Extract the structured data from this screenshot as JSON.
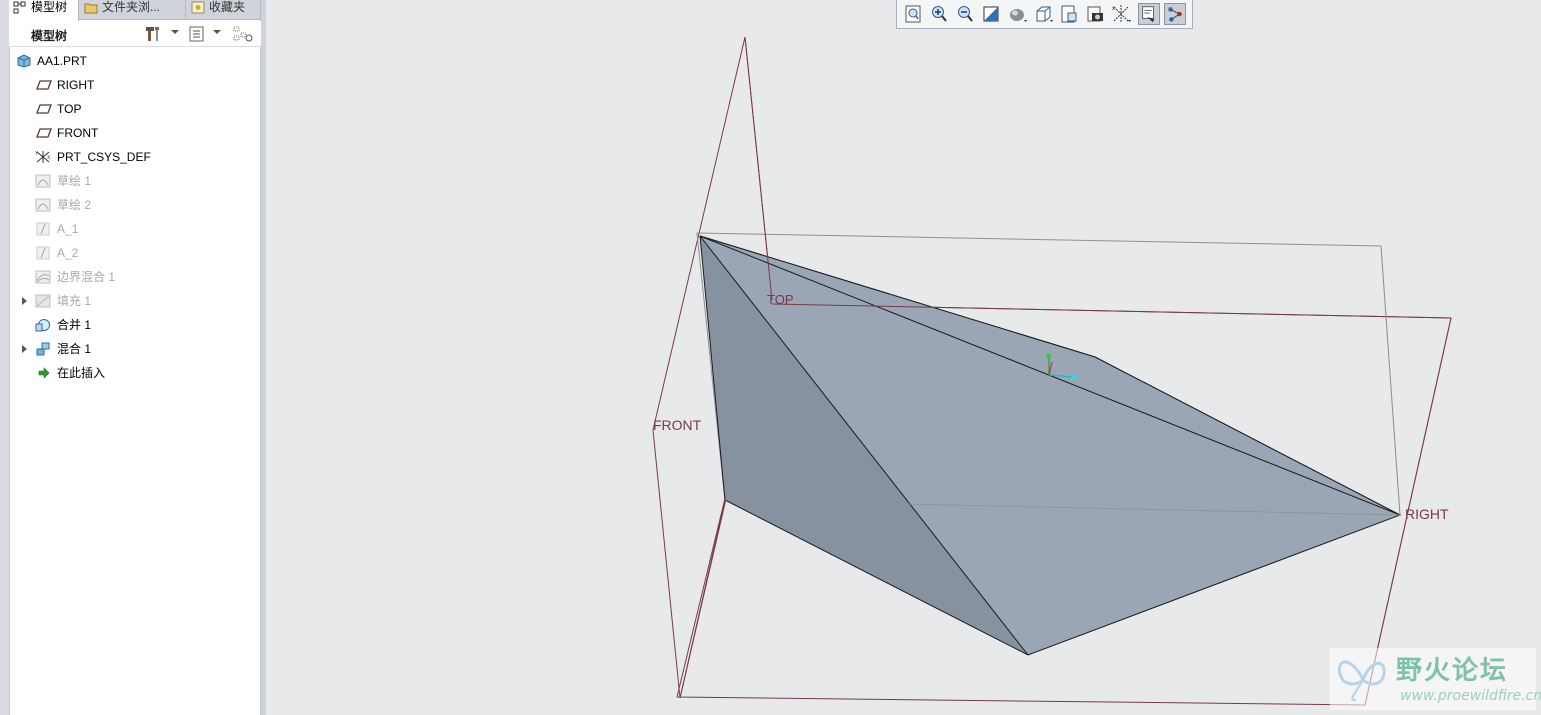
{
  "tabs": [
    {
      "label": "模型树",
      "icon": "model-tree-icon"
    },
    {
      "label": "文件夹浏...",
      "icon": "folder-browser-icon"
    },
    {
      "label": "收藏夹",
      "icon": "favorites-icon"
    }
  ],
  "tree_toolbar": {
    "title": "模型树",
    "settings_icon": "tools-icon",
    "show_icon": "show-list-icon",
    "filter_icon": "tree-filter-icon"
  },
  "tree": [
    {
      "label": "AA1.PRT",
      "icon": "part-icon",
      "dim": false,
      "expandable": false
    },
    {
      "label": "RIGHT",
      "icon": "datum-plane-icon",
      "dim": false,
      "expandable": false
    },
    {
      "label": "TOP",
      "icon": "datum-plane-icon",
      "dim": false,
      "expandable": false
    },
    {
      "label": "FRONT",
      "icon": "datum-plane-icon",
      "dim": false,
      "expandable": false
    },
    {
      "label": "PRT_CSYS_DEF",
      "icon": "csys-icon",
      "dim": false,
      "expandable": false
    },
    {
      "label": "草绘 1",
      "icon": "sketch-icon",
      "dim": true,
      "expandable": false
    },
    {
      "label": "草绘 2",
      "icon": "sketch-icon",
      "dim": true,
      "expandable": false
    },
    {
      "label": "A_1",
      "icon": "datum-axis-icon",
      "dim": true,
      "expandable": false
    },
    {
      "label": "A_2",
      "icon": "datum-axis-icon",
      "dim": true,
      "expandable": false
    },
    {
      "label": "边界混合 1",
      "icon": "boundary-blend-icon",
      "dim": true,
      "expandable": false
    },
    {
      "label": "填充 1",
      "icon": "fill-icon",
      "dim": true,
      "expandable": true
    },
    {
      "label": "合并 1",
      "icon": "merge-icon",
      "dim": false,
      "expandable": false
    },
    {
      "label": "混合 1",
      "icon": "blend-icon",
      "dim": false,
      "expandable": true
    },
    {
      "label": "在此插入",
      "icon": "insert-here-icon",
      "dim": false,
      "expandable": false
    }
  ],
  "view_toolbar": [
    {
      "name": "refit",
      "icon": "refit-icon",
      "pressed": false
    },
    {
      "name": "zoom-in",
      "icon": "zoom-in-icon",
      "pressed": false
    },
    {
      "name": "zoom-out",
      "icon": "zoom-out-icon",
      "pressed": false
    },
    {
      "name": "repaint",
      "icon": "repaint-icon",
      "pressed": false
    },
    {
      "name": "display-style",
      "icon": "display-style-icon",
      "pressed": false
    },
    {
      "name": "saved-orientations",
      "icon": "saved-orientations-icon",
      "pressed": false
    },
    {
      "name": "view-manager",
      "icon": "view-manager-icon",
      "pressed": false
    },
    {
      "name": "perspective",
      "icon": "camera-icon",
      "pressed": false
    },
    {
      "name": "datum-display",
      "icon": "datum-display-icon",
      "pressed": false
    },
    {
      "name": "annotation-display",
      "icon": "annotation-display-icon",
      "pressed": true
    },
    {
      "name": "spin-center",
      "icon": "spin-center-icon",
      "pressed": true
    }
  ],
  "plane_labels": {
    "top": "TOP",
    "front": "FRONT",
    "right": "RIGHT"
  },
  "watermark": {
    "title": "野火论坛",
    "url": "www.proewildfire.cn"
  },
  "colors": {
    "datum_plane": "#7a3a47",
    "solid_light": "#9aa6b6",
    "solid_dark": "#6e7684",
    "solid_mid": "#8792a1",
    "background": "#e8e9eb"
  }
}
